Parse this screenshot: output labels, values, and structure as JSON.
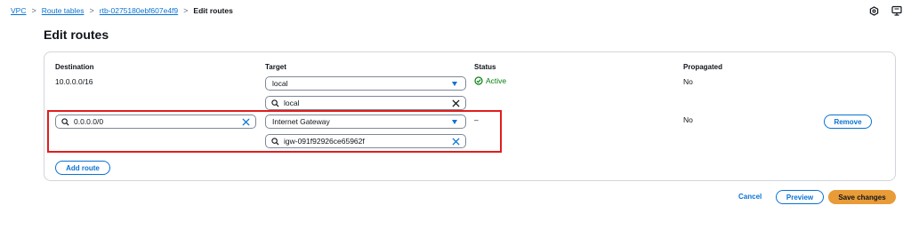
{
  "breadcrumb": {
    "items": [
      "VPC",
      "Route tables",
      "rtb-0275180ebf607e4f9"
    ],
    "current": "Edit routes",
    "separator": ">"
  },
  "header_icons": [
    "settings-hexagon-icon",
    "notifications-icon"
  ],
  "page": {
    "title": "Edit routes"
  },
  "table": {
    "columns": {
      "destination": "Destination",
      "target": "Target",
      "status": "Status",
      "propagated": "Propagated"
    },
    "rows": [
      {
        "destination": "10.0.0.0/16",
        "target_type": "local",
        "target_value": "local",
        "status": "Active",
        "propagated": "No"
      },
      {
        "destination": "0.0.0.0/0",
        "target_type": "Internet Gateway",
        "target_value": "igw-091f92926ce65962f",
        "status": "–",
        "propagated": "No",
        "remove_label": "Remove"
      }
    ],
    "add_route_label": "Add route"
  },
  "footer": {
    "cancel_label": "Cancel",
    "preview_label": "Preview",
    "save_label": "Save changes"
  },
  "colors": {
    "link": "#0972d3",
    "primary_button": "#e89b36",
    "status_active": "#037f0c",
    "highlight_box": "#e11d1d"
  }
}
